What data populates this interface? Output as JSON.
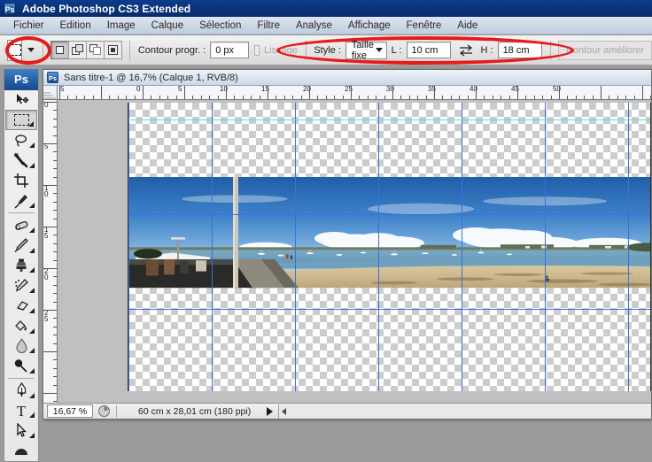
{
  "window": {
    "title": "Adobe Photoshop CS3 Extended",
    "app_icon": "Ps"
  },
  "menubar": {
    "items": [
      {
        "label": "Fichier"
      },
      {
        "label": "Edition"
      },
      {
        "label": "Image"
      },
      {
        "label": "Calque"
      },
      {
        "label": "Sélection"
      },
      {
        "label": "Filtre"
      },
      {
        "label": "Analyse"
      },
      {
        "label": "Affichage"
      },
      {
        "label": "Fenêtre"
      },
      {
        "label": "Aide"
      }
    ]
  },
  "options_bar": {
    "tool_icon": "rectangular-marquee-icon",
    "selection_modes": [
      {
        "name": "new-selection",
        "active": true
      },
      {
        "name": "add-to-selection",
        "active": false
      },
      {
        "name": "subtract-from-selection",
        "active": false
      },
      {
        "name": "intersect-selection",
        "active": false
      }
    ],
    "feather_label": "Contour progr. :",
    "feather_value": "0 px",
    "antialias_label": "Lissage",
    "style_label": "Style :",
    "style_value": "Taille fixe",
    "width_label": "L :",
    "width_value": "10 cm",
    "swap_icon": "swap-arrows-icon",
    "height_label": "H :",
    "height_value": "18 cm",
    "refine_edge_label": "Contour améliorer"
  },
  "toolbox": {
    "logo": "Ps",
    "tools": [
      {
        "name": "move-tool",
        "glyph": "move"
      },
      {
        "name": "rectangular-marquee-tool",
        "glyph": "marquee",
        "selected": true
      },
      {
        "name": "lasso-tool",
        "glyph": "lasso"
      },
      {
        "name": "magic-wand-tool",
        "glyph": "wand"
      },
      {
        "name": "crop-tool",
        "glyph": "crop"
      },
      {
        "name": "eyedropper-tool",
        "glyph": "eyedropper"
      },
      {
        "name": "healing-brush-tool",
        "glyph": "healing"
      },
      {
        "name": "brush-tool",
        "glyph": "brush"
      },
      {
        "name": "clone-stamp-tool",
        "glyph": "stamp"
      },
      {
        "name": "history-brush-tool",
        "glyph": "historybrush"
      },
      {
        "name": "eraser-tool",
        "glyph": "eraser"
      },
      {
        "name": "paint-bucket-tool",
        "glyph": "bucket"
      },
      {
        "name": "blur-tool",
        "glyph": "blur"
      },
      {
        "name": "dodge-tool",
        "glyph": "dodge"
      },
      {
        "name": "pen-tool",
        "glyph": "pen"
      },
      {
        "name": "type-tool",
        "glyph": "T"
      },
      {
        "name": "path-selection-tool",
        "glyph": "arrow"
      },
      {
        "name": "shape-tool",
        "glyph": "shape"
      }
    ]
  },
  "document": {
    "title": "Sans titre-1 @ 16,7% (Calque 1, RVB/8)",
    "icon": "Ps",
    "zoom": "16,67 %",
    "size_info": "60 cm x 28,01 cm (180 ppi)",
    "ruler_unit": "cm",
    "h_ruler_labels": [
      "5",
      "0",
      "5",
      "10",
      "15",
      "20",
      "25",
      "30",
      "35",
      "40",
      "45",
      "50"
    ],
    "v_ruler_labels": [
      "0",
      "5",
      "10",
      "15",
      "20",
      "25"
    ],
    "guides": {
      "vertical_cm": [
        0,
        10,
        20,
        30,
        40,
        50,
        60
      ],
      "horizontal_cm": [
        10,
        21
      ],
      "cyan_horizontal_cm": [
        1.5
      ]
    },
    "canvas_description": "Panoramic beach photograph: blue sky with cumulus clouds, a bay with small moored boats, a seawall promenade with a lamppost at left, and a wide sandy beach in the foreground. Transparent checkerboard above and below the photo layer."
  },
  "annotations": [
    {
      "name": "annotation-ellipse-marquee-tool",
      "color": "#e8191b"
    },
    {
      "name": "annotation-ellipse-fixed-size-style",
      "color": "#e8191b"
    }
  ],
  "colors": {
    "titlebar": "#0a357c",
    "annotation_red": "#e8191b",
    "guide_blue": "#3c6fe0",
    "guide_cyan": "#4fe3e3"
  }
}
